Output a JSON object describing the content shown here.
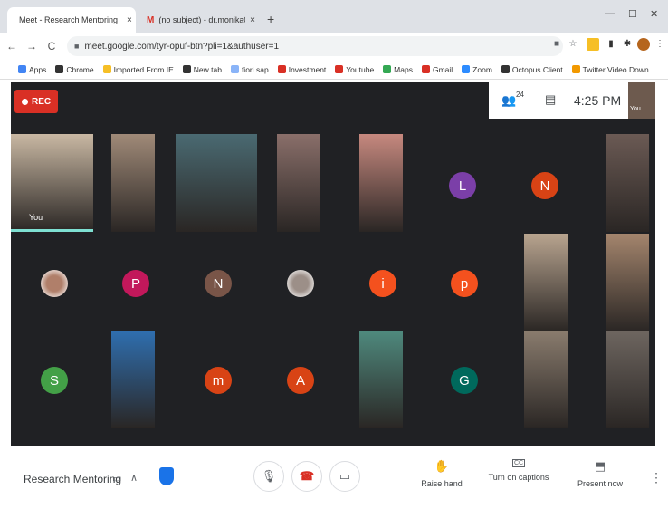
{
  "browser": {
    "tabs": [
      {
        "label": "Meet - Research Mentoring",
        "active": true
      },
      {
        "label": "(no subject) - dr.monika0016@gm",
        "active": false
      }
    ],
    "new_tab": "+",
    "tab_close": "×",
    "window_controls": [
      "—",
      "☐",
      "✕"
    ],
    "url": "meet.google.com/tyr-opuf-btn?pli=1&authuser=1",
    "bookmarks": [
      {
        "label": "Apps",
        "icon": "apps-grid-icon",
        "color": "#4285f4"
      },
      {
        "label": "Chrome",
        "icon": "globe-icon",
        "color": "#333333"
      },
      {
        "label": "Imported From IE",
        "icon": "folder-icon",
        "color": "#f6bf26"
      },
      {
        "label": "New tab",
        "icon": "globe-icon",
        "color": "#333333"
      },
      {
        "label": "fiori sap",
        "icon": "folder-icon",
        "color": "#8ab4f8"
      },
      {
        "label": "Investment",
        "icon": "investment-icon",
        "color": "#d93025"
      },
      {
        "label": "Youtube",
        "icon": "youtube-icon",
        "color": "#d93025"
      },
      {
        "label": "Maps",
        "icon": "maps-icon",
        "color": "#34a853"
      },
      {
        "label": "Gmail",
        "icon": "gmail-icon",
        "color": "#d93025"
      },
      {
        "label": "Zoom",
        "icon": "zoom-icon",
        "color": "#2d8cff"
      },
      {
        "label": "Octopus Client",
        "icon": "globe-icon",
        "color": "#333333"
      },
      {
        "label": "Twitter Video Down...",
        "icon": "download-icon",
        "color": "#f29900"
      }
    ]
  },
  "meet": {
    "rec_label": "REC",
    "participants_count": "24",
    "time": "4:25 PM",
    "self_label": "You",
    "self_tile_label": "You",
    "avatars": [
      {
        "letter": "L",
        "color": "#7b3fa8"
      },
      {
        "letter": "N",
        "color": "#d84315"
      },
      {
        "letter": "P",
        "color": "#c2185b"
      },
      {
        "letter": "N",
        "color": "#795548"
      },
      {
        "letter": "i",
        "color": "#f4511e"
      },
      {
        "letter": "p",
        "color": "#f4511e"
      },
      {
        "letter": "S",
        "color": "#43a047"
      },
      {
        "letter": "m",
        "color": "#d84315"
      },
      {
        "letter": "A",
        "color": "#d84315"
      },
      {
        "letter": "G",
        "color": "#00695c"
      }
    ]
  },
  "controls": {
    "meeting_name": "Research Mentoring",
    "raise_hand": "Raise hand",
    "captions": "Turn on captions",
    "captions_icon_text": "CC",
    "present": "Present now"
  }
}
